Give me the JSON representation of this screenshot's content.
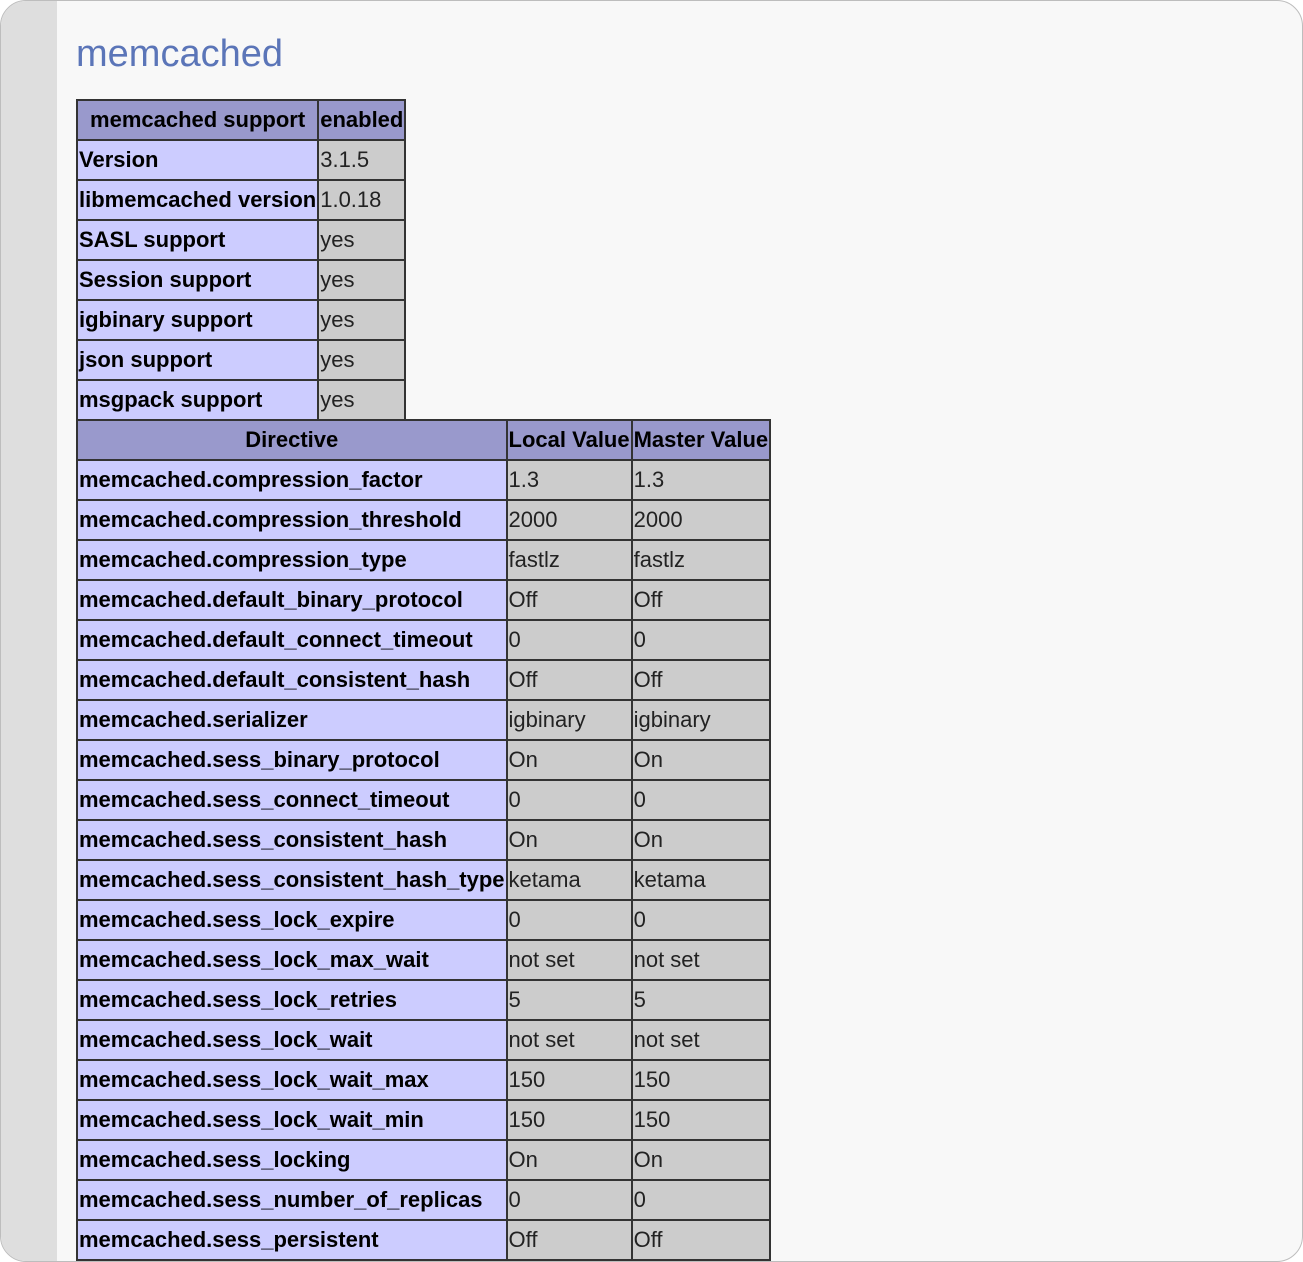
{
  "page": {
    "title": "memcached"
  },
  "support_table": {
    "headers": [
      "memcached support",
      "enabled"
    ],
    "rows": [
      {
        "name": "Version",
        "value": "3.1.5"
      },
      {
        "name": "libmemcached version",
        "value": "1.0.18"
      },
      {
        "name": "SASL support",
        "value": "yes"
      },
      {
        "name": "Session support",
        "value": "yes"
      },
      {
        "name": "igbinary support",
        "value": "yes"
      },
      {
        "name": "json support",
        "value": "yes"
      },
      {
        "name": "msgpack support",
        "value": "yes"
      }
    ]
  },
  "directive_table": {
    "headers": [
      "Directive",
      "Local Value",
      "Master Value"
    ],
    "rows": [
      {
        "directive": "memcached.compression_factor",
        "local": "1.3",
        "master": "1.3"
      },
      {
        "directive": "memcached.compression_threshold",
        "local": "2000",
        "master": "2000"
      },
      {
        "directive": "memcached.compression_type",
        "local": "fastlz",
        "master": "fastlz"
      },
      {
        "directive": "memcached.default_binary_protocol",
        "local": "Off",
        "master": "Off"
      },
      {
        "directive": "memcached.default_connect_timeout",
        "local": "0",
        "master": "0"
      },
      {
        "directive": "memcached.default_consistent_hash",
        "local": "Off",
        "master": "Off"
      },
      {
        "directive": "memcached.serializer",
        "local": "igbinary",
        "master": "igbinary"
      },
      {
        "directive": "memcached.sess_binary_protocol",
        "local": "On",
        "master": "On"
      },
      {
        "directive": "memcached.sess_connect_timeout",
        "local": "0",
        "master": "0"
      },
      {
        "directive": "memcached.sess_consistent_hash",
        "local": "On",
        "master": "On"
      },
      {
        "directive": "memcached.sess_consistent_hash_type",
        "local": "ketama",
        "master": "ketama"
      },
      {
        "directive": "memcached.sess_lock_expire",
        "local": "0",
        "master": "0"
      },
      {
        "directive": "memcached.sess_lock_max_wait",
        "local": "not set",
        "master": "not set"
      },
      {
        "directive": "memcached.sess_lock_retries",
        "local": "5",
        "master": "5"
      },
      {
        "directive": "memcached.sess_lock_wait",
        "local": "not set",
        "master": "not set"
      },
      {
        "directive": "memcached.sess_lock_wait_max",
        "local": "150",
        "master": "150"
      },
      {
        "directive": "memcached.sess_lock_wait_min",
        "local": "150",
        "master": "150"
      },
      {
        "directive": "memcached.sess_locking",
        "local": "On",
        "master": "On"
      },
      {
        "directive": "memcached.sess_number_of_replicas",
        "local": "0",
        "master": "0"
      },
      {
        "directive": "memcached.sess_persistent",
        "local": "Off",
        "master": "Off"
      },
      {
        "directive": "",
        "local": "",
        "master": ""
      }
    ]
  }
}
